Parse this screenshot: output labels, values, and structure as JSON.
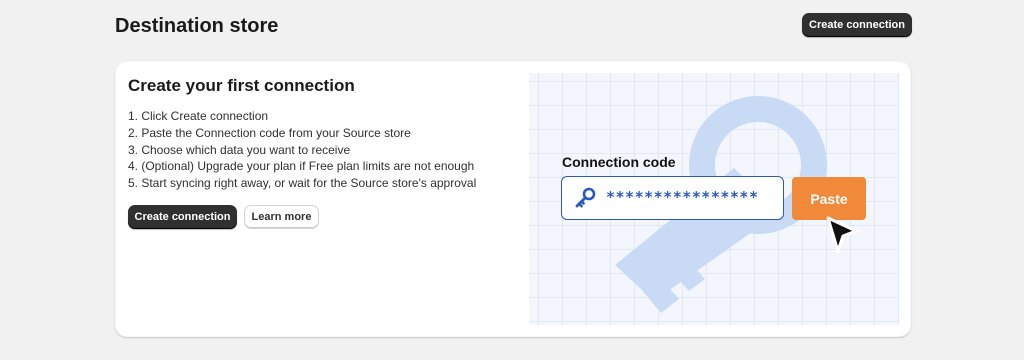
{
  "header": {
    "title": "Destination store",
    "create_button": "Create connection"
  },
  "card": {
    "title": "Create your first connection",
    "steps": [
      "1. Click Create connection",
      "2. Paste the Connection code from your Source store",
      "3. Choose which data you want to receive",
      "4. (Optional) Upgrade your plan if Free plan limits are not enough",
      "5. Start syncing right away, or wait for the Source store's approval"
    ],
    "create_button": "Create connection",
    "learn_more_button": "Learn more"
  },
  "illustration": {
    "label": "Connection code",
    "code_value": "****************",
    "paste_button": "Paste",
    "icons": [
      "key-icon",
      "cursor-arrow-icon",
      "background-key-icon"
    ]
  },
  "colors": {
    "page_background": "#f1f1f1",
    "primary_button": "#303030",
    "accent_blue": "#2b58c4",
    "paste_orange": "#f0893a",
    "illustration_key": "#c9daf5"
  }
}
